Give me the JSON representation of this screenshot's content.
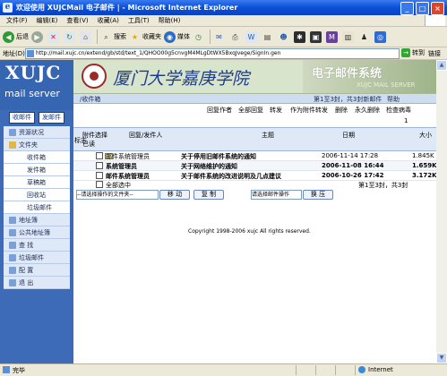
{
  "window": {
    "title": "欢迎使用 XUJCMail 电子邮件 | - Microsoft Internet Explorer",
    "minimize": "_",
    "maximize": "□",
    "close": "×"
  },
  "menubar": [
    "文件(F)",
    "编辑(E)",
    "查看(V)",
    "收藏(A)",
    "工具(T)",
    "帮助(H)"
  ],
  "toolbar": {
    "back": "后退",
    "search": "搜索",
    "favorites": "收藏夹",
    "media": "媒体"
  },
  "address": {
    "label": "地址(D)",
    "url": "http://mail.xujc.cn/extend/gb/std/text_1/QHOO00g5cnvgM4MLgDtWX5BxqJvege/SignIn.gen",
    "go": "转到",
    "links": "链接"
  },
  "status": {
    "done": "完毕",
    "zone": "Internet"
  },
  "logo": {
    "title": "XUJC",
    "subtitle": "mail server"
  },
  "nav": {
    "receive": "收邮件",
    "send": "发邮件",
    "items": [
      {
        "label": "资源状况",
        "type": "main"
      },
      {
        "label": "文件夹",
        "type": "main"
      },
      {
        "label": "收件箱",
        "type": "sub"
      },
      {
        "label": "发件箱",
        "type": "sub"
      },
      {
        "label": "草稿箱",
        "type": "sub"
      },
      {
        "label": "回收站",
        "type": "sub"
      },
      {
        "label": "垃圾邮件",
        "type": "sub"
      },
      {
        "label": "地址簿",
        "type": "main"
      },
      {
        "label": "公共地址簿",
        "type": "main"
      },
      {
        "label": "查  找",
        "type": "main"
      },
      {
        "label": "垃圾邮件",
        "type": "main"
      },
      {
        "label": "配  置",
        "type": "main"
      },
      {
        "label": "退  出",
        "type": "main"
      }
    ]
  },
  "banner": {
    "calligraphy": "厦门大学嘉庚学院",
    "system_name": "电子邮件系统",
    "system_name_en": "XUJC MAIL SERVER"
  },
  "inbox": {
    "path": "/收件箱",
    "page_info": "第1至3封，共3封",
    "page_info_right": "第1至3封，共3封新邮件",
    "help": "帮助",
    "page_num": "1"
  },
  "actions": [
    "回复作者",
    "全部回复",
    "转发",
    "作为附件转发",
    "删除",
    "永久删除",
    "检查病毒"
  ],
  "table": {
    "headers": {
      "flag": "标志",
      "attach": "附件",
      "status": "已读",
      "select": "选择",
      "sender": "回复/发件人",
      "subject": "主题",
      "date": "日期",
      "size": "大小"
    },
    "rows": [
      {
        "sender": "邮件系统管理员",
        "subject": "关于停用旧邮件系统的通知",
        "date": "2006-11-14 17:28",
        "size": "1.845K"
      },
      {
        "sender": "系统管理员",
        "subject": "关于网络维护的通知",
        "date": "2006-11-08 16:44",
        "size": "1.659K"
      },
      {
        "sender": "邮件系统管理员",
        "subject": "关于邮件系统的改进说明及几点建议",
        "date": "2006-10-26 17:42",
        "size": "3.172K"
      }
    ]
  },
  "footer": {
    "select_all": "全部选中",
    "folder_select": "--请选择操作的文件夹--",
    "move": "移  动",
    "copy": "复  制",
    "op_select": "请选择邮件操作",
    "convert": "换  压"
  },
  "copyright": "Copyright 1998-2006 xujc All rights reserved."
}
